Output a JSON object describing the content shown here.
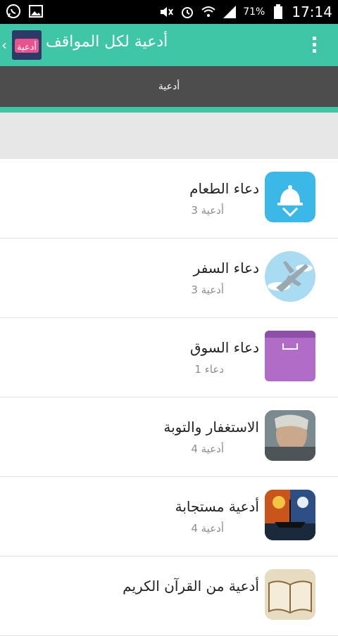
{
  "status_bar": {
    "battery": "71%",
    "time": "17:14",
    "icons": [
      "whatsapp-icon",
      "gallery-icon",
      "mute-icon",
      "alarm-icon",
      "wifi-icon",
      "signal-icon",
      "battery-icon"
    ]
  },
  "app_bar": {
    "title": "أدعية لكل المواقف",
    "logo_text": "أدعية",
    "back_glyph": "‹",
    "colors": {
      "bar": "#3ec6a7",
      "tab": "#4d4d4d"
    }
  },
  "tabs": [
    {
      "label": "أدعية"
    }
  ],
  "items": [
    {
      "title": "دعاء  الطعام",
      "sub": "3 أدعية",
      "icon": "food-bell-icon"
    },
    {
      "title": "دعاء السفر",
      "sub": "3 أدعية",
      "icon": "airplane-icon"
    },
    {
      "title": "دعاء السوق",
      "sub": "1 دعاء",
      "icon": "shopping-bag-icon"
    },
    {
      "title": "الاستغفار والتوبة",
      "sub": "4 أدعية",
      "icon": "repentance-image-icon"
    },
    {
      "title": "أدعية مستجابة",
      "sub": "4 أدعية",
      "icon": "night-boat-image-icon"
    },
    {
      "title": "أدعية من القرآن الكريم",
      "sub": "",
      "icon": "quran-book-icon"
    }
  ]
}
